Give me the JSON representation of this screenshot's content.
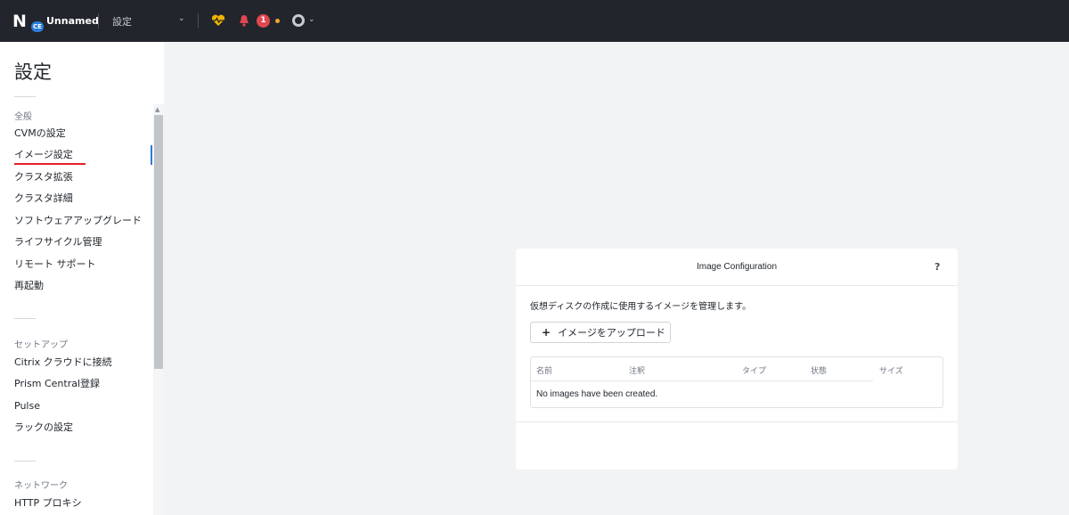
{
  "topbar": {
    "logo_letter": "N",
    "logo_badge": "CE",
    "cluster_name": "Unnamed",
    "menu_title": "設定",
    "menu_caret": "⌄",
    "alert_count": "1",
    "task_caret": "⌄",
    "colors": {
      "health": "#f1b400",
      "alert": "#e0474f",
      "warning": "#f0a530"
    }
  },
  "sidebar": {
    "title": "設定",
    "groups": [
      {
        "label": "全般",
        "items": [
          "CVMの設定",
          "イメージ設定",
          "クラスタ拡張",
          "クラスタ詳細",
          "ソフトウェアアップグレード",
          "ライフサイクル管理",
          "リモート サポート",
          "再起動"
        ]
      },
      {
        "label": "セットアップ",
        "items": [
          "Citrix クラウドに接続",
          "Prism Central登録",
          "Pulse",
          "ラックの設定"
        ]
      },
      {
        "label": "ネットワーク",
        "items": [
          "HTTP プロキシ"
        ]
      }
    ],
    "active_item": "イメージ設定",
    "scroll_up_glyph": "▲"
  },
  "dialog": {
    "title": "Image Configuration",
    "help": "?",
    "description": "仮想ディスクの作成に使用するイメージを管理します。",
    "upload_plus": "+",
    "upload_label": "イメージをアップロード",
    "table": {
      "columns": [
        "名前",
        "注釈",
        "タイプ",
        "状態",
        "サイズ"
      ],
      "empty_message": "No images have been created."
    }
  }
}
